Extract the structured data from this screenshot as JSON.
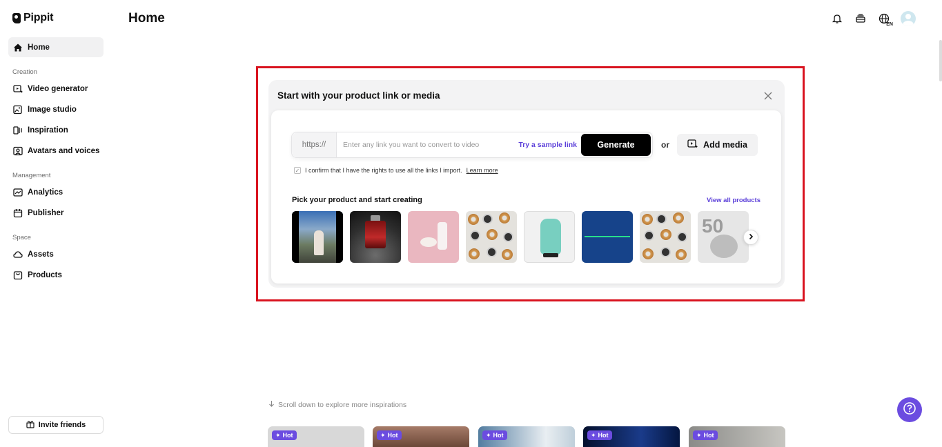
{
  "app": {
    "name": "Pippit"
  },
  "header": {
    "title": "Home",
    "language_badge": "EN"
  },
  "sidebar": {
    "home": "Home",
    "sections": {
      "creation": "Creation",
      "management": "Management",
      "space": "Space"
    },
    "items": [
      {
        "label": "Video generator",
        "icon": "video-plus-icon"
      },
      {
        "label": "Image studio",
        "icon": "image-edit-icon"
      },
      {
        "label": "Inspiration",
        "icon": "inspiration-icon"
      },
      {
        "label": "Avatars and voices",
        "icon": "avatar-icon"
      },
      {
        "label": "Analytics",
        "icon": "chart-icon"
      },
      {
        "label": "Publisher",
        "icon": "calendar-icon"
      },
      {
        "label": "Assets",
        "icon": "cloud-icon"
      },
      {
        "label": "Products",
        "icon": "bag-icon"
      }
    ],
    "invite": "Invite friends"
  },
  "card": {
    "title": "Start with your product link or media",
    "link_prefix": "https://",
    "link_placeholder": "Enter any link you want to convert to video",
    "link_value": "",
    "sample_link": "Try a sample link",
    "generate": "Generate",
    "or": "or",
    "add_media": "Add media",
    "confirm_text": "I confirm that I have the rights to use all the links I import.",
    "learn_more": "Learn more",
    "pick_title": "Pick your product and start creating",
    "view_all": "View all products",
    "thumb_text_50": "50"
  },
  "lower": {
    "scroll_hint": "Scroll down to explore more inspirations",
    "hot_label": "Hot"
  },
  "colors": {
    "accent": "#6b4ce0",
    "link": "#5b3fd9",
    "highlight": "#d9131f"
  }
}
